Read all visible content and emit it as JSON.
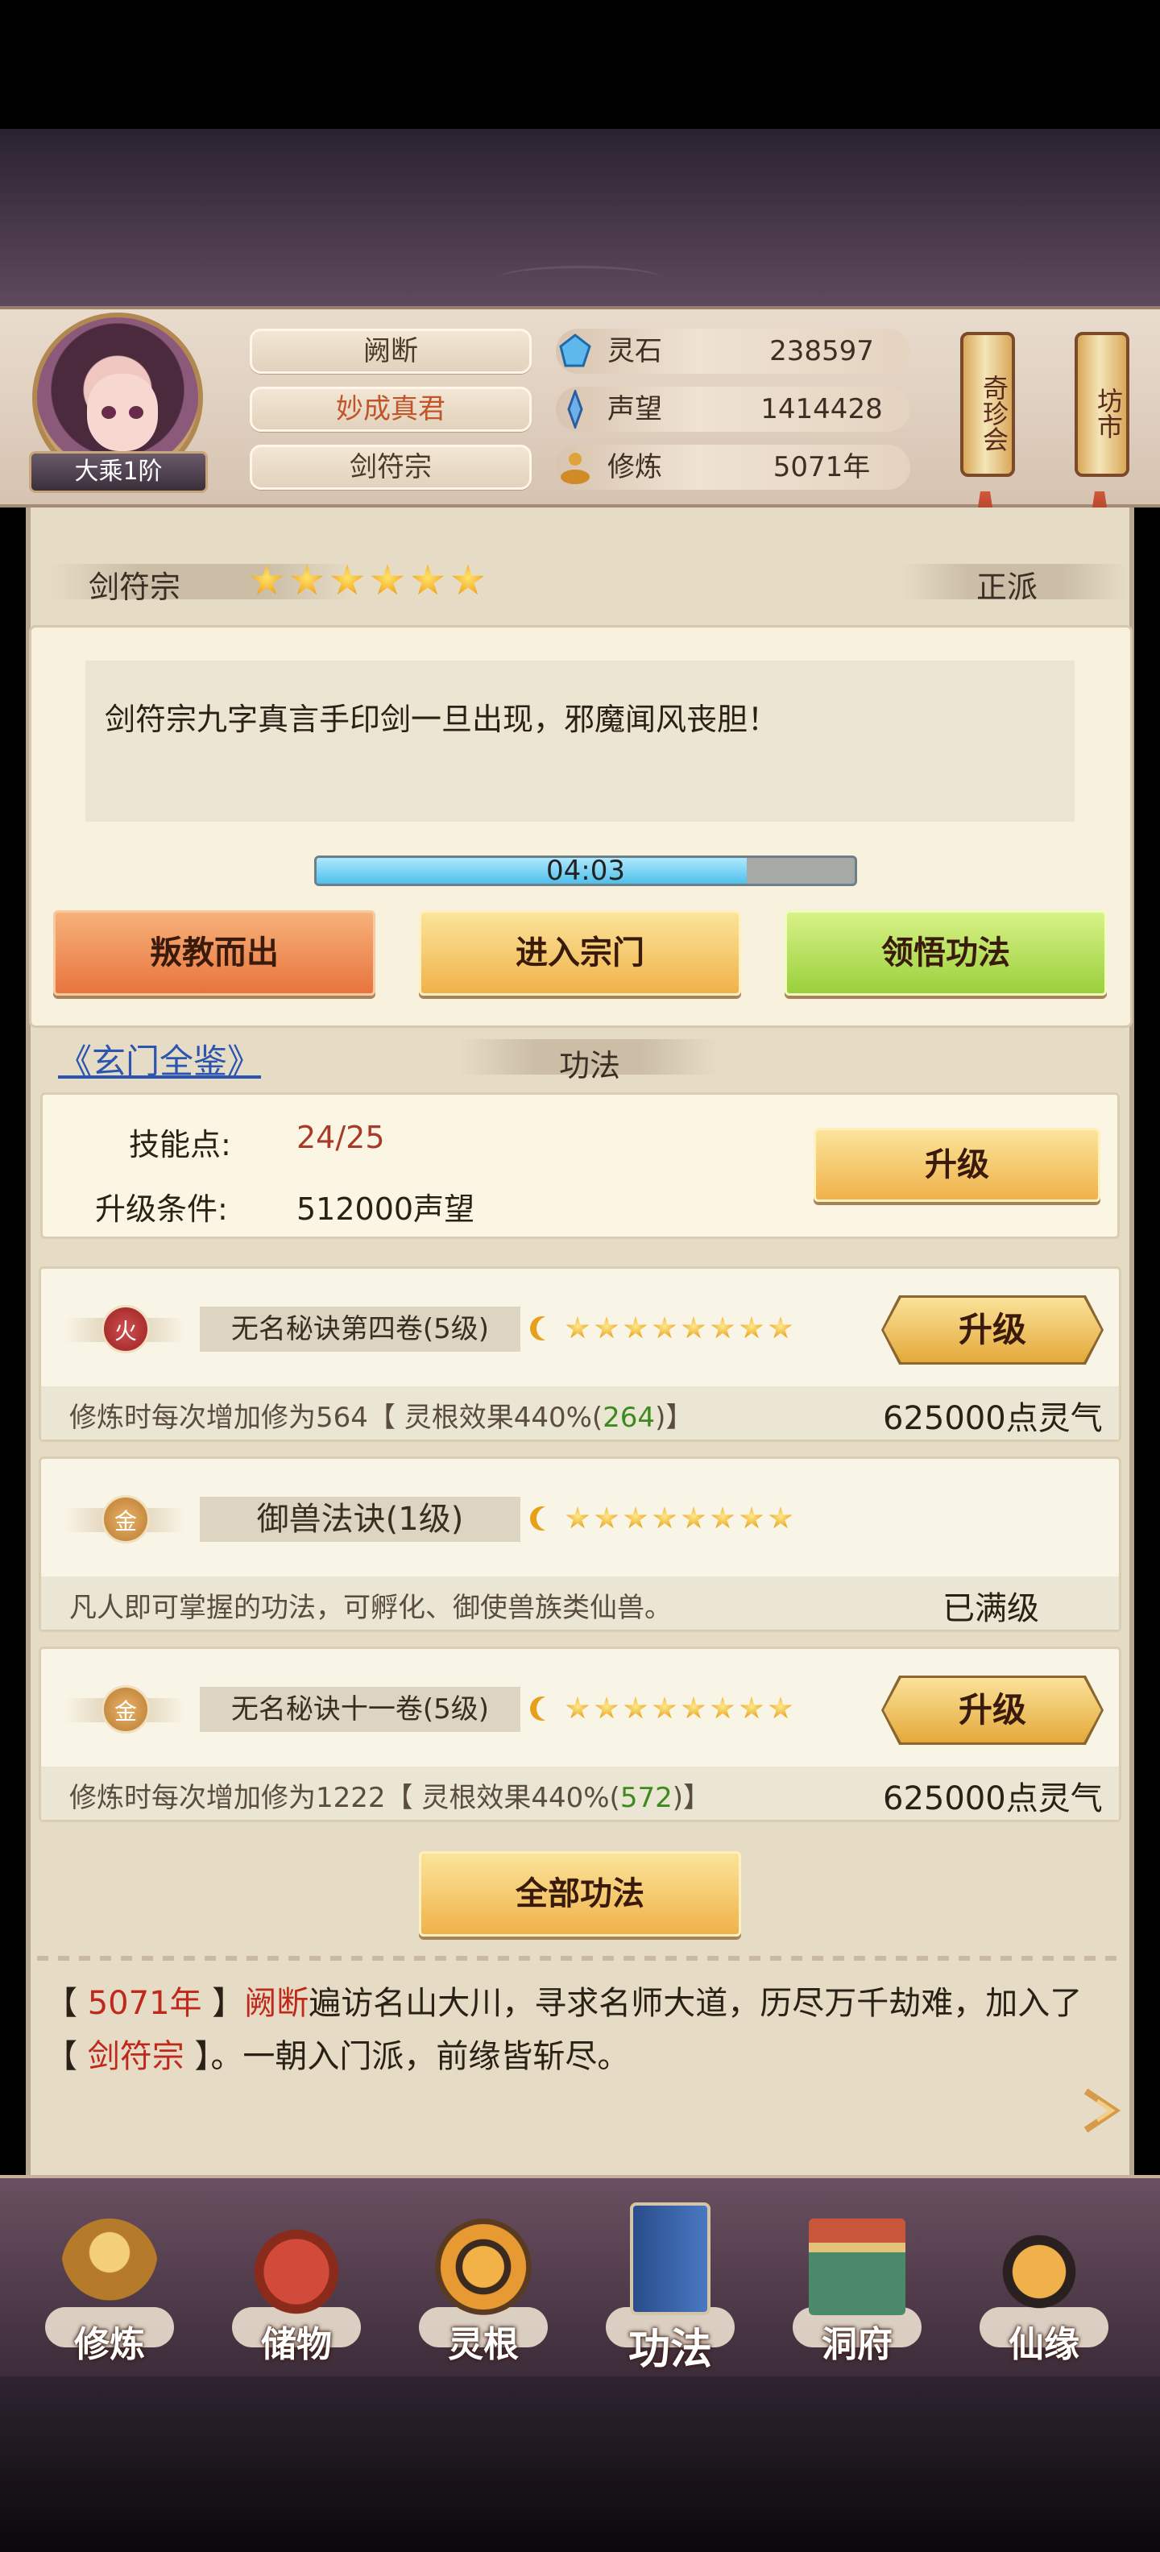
{
  "player": {
    "name": "阙断",
    "title": "妙成真君",
    "sect": "剑符宗",
    "rank": "大乘1阶"
  },
  "resources": [
    {
      "icon": "spirit-stone-icon",
      "label": "灵石",
      "value": "238597"
    },
    {
      "icon": "reputation-icon",
      "label": "声望",
      "value": "1414428"
    },
    {
      "icon": "cultivation-icon",
      "label": "修炼",
      "value": "5071年"
    }
  ],
  "side_buttons": {
    "treasure": "奇珍会",
    "market": "坊市"
  },
  "sect_panel": {
    "name": "剑符宗",
    "stars": 6,
    "alignment": "正派",
    "description": "剑符宗九字真言手印剑一旦出现，邪魔闻风丧胆！",
    "timer": "04:03",
    "timer_progress": 0.8,
    "buttons": {
      "leave": "叛教而出",
      "enter": "进入宗门",
      "comprehend": "领悟功法"
    }
  },
  "skills_section": {
    "link": "《玄门全鉴》",
    "title": "功法",
    "skill_points_label": "技能点:",
    "skill_points_value": "24/25",
    "upgrade_cond_label": "升级条件:",
    "upgrade_cond_value": "512000声望",
    "upgrade_button": "升级",
    "all_button": "全部功法"
  },
  "techniques": [
    {
      "element": "火",
      "name": "无名秘诀第四卷(5级)",
      "stars": 8,
      "button": "升级",
      "effect_prefix": "修炼时每次增加修为564【 灵根效果440%(",
      "effect_bonus": "264",
      "effect_suffix": ")】",
      "cost": "625000点灵气"
    },
    {
      "element": "金",
      "name": "御兽法诀(1级)",
      "stars": 8,
      "effect_text": "凡人即可掌握的功法，可孵化、御使兽族类仙兽。",
      "status": "已满级"
    },
    {
      "element": "金",
      "name": "无名秘诀十一卷(5级)",
      "stars": 8,
      "button": "升级",
      "effect_prefix": "修炼时每次增加修为1222【 灵根效果440%(",
      "effect_bonus": "572",
      "effect_suffix": ")】",
      "cost": "625000点灵气"
    }
  ],
  "log": {
    "year": "5071年",
    "name": "阙断",
    "text1": "遍访名山大川，寻求名师大道，历尽万千劫难，加入了",
    "sect": "剑符宗",
    "text2": "。一朝入门派，前缘皆斩尽。",
    "bracket_open": "【",
    "bracket_close": "】"
  },
  "nav": [
    {
      "label": "修炼",
      "icon": "cultivate-icon"
    },
    {
      "label": "储物",
      "icon": "storage-bag-icon"
    },
    {
      "label": "灵根",
      "icon": "spirit-root-icon"
    },
    {
      "label": "功法",
      "icon": "technique-book-icon"
    },
    {
      "label": "洞府",
      "icon": "cave-mansion-icon"
    },
    {
      "label": "仙缘",
      "icon": "immortal-fate-icon"
    }
  ],
  "colors": {
    "accent_gold": "#f0b24a",
    "danger": "#c0281c",
    "bonus_green": "#3d8a1f"
  }
}
